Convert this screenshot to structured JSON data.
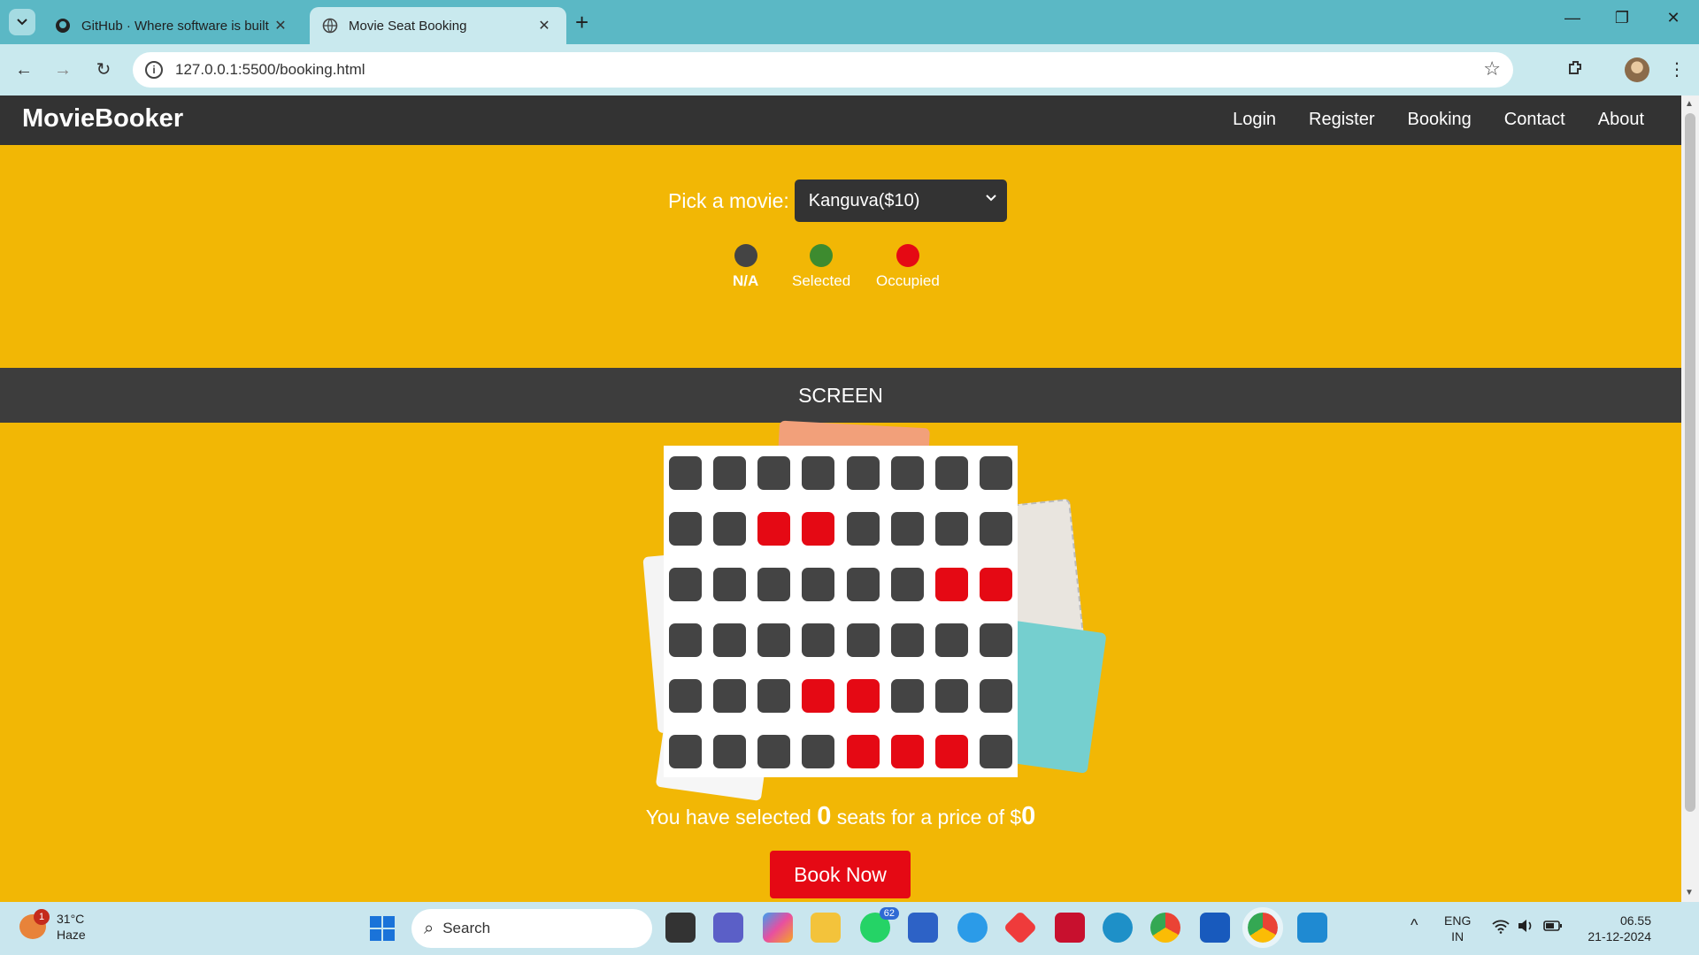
{
  "browser": {
    "tabs": [
      {
        "title": "GitHub · Where software is built",
        "active": false,
        "icon": "github-icon"
      },
      {
        "title": "Movie Seat Booking",
        "active": true,
        "icon": "globe-icon"
      }
    ],
    "url": "127.0.0.1:5500/booking.html"
  },
  "site": {
    "brand": "MovieBooker",
    "nav": [
      "Login",
      "Register",
      "Booking",
      "Contact",
      "About"
    ]
  },
  "picker": {
    "label": "Pick a movie:",
    "selected": "Kanguva($10)"
  },
  "legend": [
    {
      "label": "N/A",
      "color": "#444444"
    },
    {
      "label": "Selected",
      "color": "#3d8b2f"
    },
    {
      "label": "Occupied",
      "color": "#e50914"
    }
  ],
  "screen_label": "SCREEN",
  "seats": [
    [
      "na",
      "na",
      "na",
      "na",
      "na",
      "na",
      "na",
      "na"
    ],
    [
      "na",
      "na",
      "occupied",
      "occupied",
      "na",
      "na",
      "na",
      "na"
    ],
    [
      "na",
      "na",
      "na",
      "na",
      "na",
      "na",
      "occupied",
      "occupied"
    ],
    [
      "na",
      "na",
      "na",
      "na",
      "na",
      "na",
      "na",
      "na"
    ],
    [
      "na",
      "na",
      "na",
      "occupied",
      "occupied",
      "na",
      "na",
      "na"
    ],
    [
      "na",
      "na",
      "na",
      "na",
      "occupied",
      "occupied",
      "occupied",
      "na"
    ]
  ],
  "summary": {
    "prefix": "You have selected",
    "count": "0",
    "middle": "seats for a price of $",
    "total": "0"
  },
  "book_button": "Book Now",
  "taskbar": {
    "weather_temp": "31°C",
    "weather_desc": "Haze",
    "weather_alerts": "1",
    "search_placeholder": "Search",
    "whatsapp_badge": "62",
    "lang_top": "ENG",
    "lang_bottom": "IN",
    "time": "06.55",
    "date": "21-12-2024"
  },
  "colors": {
    "page_bg": "#f2b705",
    "navbar": "#333333",
    "occupied": "#e50914",
    "selected": "#3d8b2f",
    "available": "#444444"
  }
}
